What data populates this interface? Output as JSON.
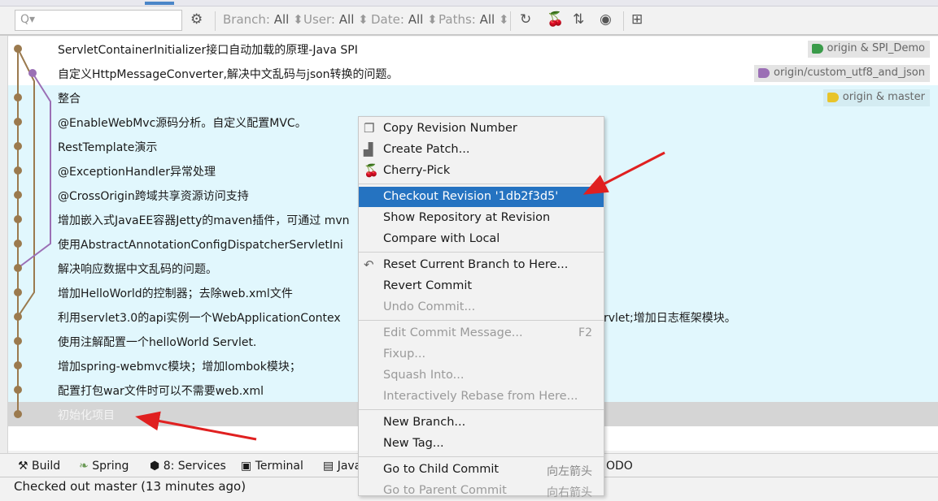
{
  "toolbar": {
    "search_placeholder": "Q▾",
    "filters": [
      {
        "label": "Branch:",
        "value": "All"
      },
      {
        "label": "User:",
        "value": "All"
      },
      {
        "label": "Date:",
        "value": "All"
      },
      {
        "label": "Paths:",
        "value": "All"
      }
    ]
  },
  "commits": [
    {
      "message": "ServletContainerInitializer接口自动加载的原理-Java SPI",
      "tag": "origin & SPI_Demo",
      "tag_color": "#3a9b4a"
    },
    {
      "message": "自定义HttpMessageConverter,解决中文乱码与json转换的问题。",
      "tag": "origin/custom_utf8_and_json",
      "tag_color": "#9b6fb5"
    },
    {
      "message": "整合",
      "tag": "origin & master",
      "tag_color": "#e8c42a"
    },
    {
      "message": "@EnableWebMvc源码分析。自定义配置MVC。"
    },
    {
      "message": "RestTemplate演示"
    },
    {
      "message": "@ExceptionHandler异常处理"
    },
    {
      "message": "@CrossOrigin跨域共享资源访问支持"
    },
    {
      "message": "增加嵌入式JavaEE容器Jetty的maven插件，可通过 mvn"
    },
    {
      "message": "使用AbstractAnnotationConfigDispatcherServletIni"
    },
    {
      "message": "解决响应数据中文乱码的问题。"
    },
    {
      "message": "增加HelloWorld的控制器；去除web.xml文件"
    },
    {
      "message": "利用servlet3.0的api实例一个WebApplicationContex",
      "tail": "rvlet;增加日志框架模块。"
    },
    {
      "message": "使用注解配置一个helloWorld Servlet."
    },
    {
      "message": "增加spring-webmvc模块；增加lombok模块；"
    },
    {
      "message": "配置打包war文件时可以不需要web.xml"
    },
    {
      "message": "初始化项目",
      "selected": true
    }
  ],
  "context_menu": {
    "items": [
      {
        "label": "Copy Revision Number",
        "icon": "copy-icon"
      },
      {
        "label": "Create Patch...",
        "icon": "patch-icon"
      },
      {
        "label": "Cherry-Pick",
        "icon": "cherry-icon"
      },
      {
        "label": "Checkout Revision '1db2f3d5'",
        "highlighted": true
      },
      {
        "label": "Show Repository at Revision"
      },
      {
        "label": "Compare with Local"
      },
      {
        "label": "Reset Current Branch to Here...",
        "icon": "undo-icon"
      },
      {
        "label": "Revert Commit"
      },
      {
        "label": "Undo Commit...",
        "disabled": true
      },
      {
        "label": "Edit Commit Message...",
        "shortcut": "F2",
        "disabled": true
      },
      {
        "label": "Fixup...",
        "disabled": true
      },
      {
        "label": "Squash Into...",
        "disabled": true
      },
      {
        "label": "Interactively Rebase from Here...",
        "disabled": true
      },
      {
        "label": "New Branch..."
      },
      {
        "label": "New Tag..."
      },
      {
        "label": "Go to Child Commit",
        "shortcut": "向左箭头"
      },
      {
        "label": "Go to Parent Commit",
        "shortcut": "向右箭头",
        "disabled": true
      }
    ]
  },
  "bottom_tools": [
    {
      "label": "Build"
    },
    {
      "label": "Spring"
    },
    {
      "label": "8: Services"
    },
    {
      "label": "Terminal"
    },
    {
      "label": "Java"
    },
    {
      "label": "ODO"
    }
  ],
  "status": "Checked out master (13 minutes ago)",
  "colors": {
    "selection": "#2573c1",
    "row_highlight": "#e1f7fd",
    "graph_main": "#9b7a4e",
    "graph_branch": "#9b6fb5",
    "annotation_arrow": "#e02020"
  }
}
